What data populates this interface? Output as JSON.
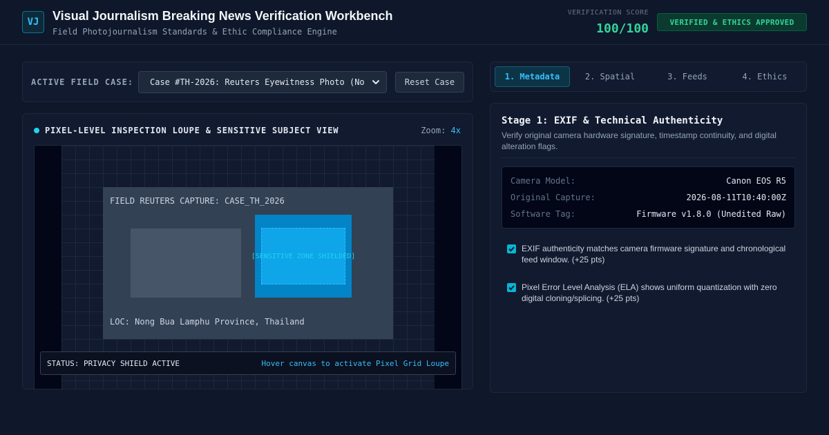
{
  "header": {
    "logo": "VJ",
    "title": "Visual Journalism Breaking News Verification Workbench",
    "subtitle": "Field Photojournalism Standards & Ethic Compliance Engine",
    "score_label": "VERIFICATION SCORE",
    "score_value": "100/100",
    "badge": "VERIFIED & ETHICS APPROVED"
  },
  "case_bar": {
    "label": "ACTIVE FIELD CASE:",
    "selected": "Case #TH-2026: Reuters Eyewitness Photo (No",
    "reset_label": "Reset Case"
  },
  "loupe": {
    "title": "PIXEL-LEVEL INSPECTION LOUPE & SENSITIVE SUBJECT VIEW",
    "zoom_label": "Zoom:",
    "zoom_value": "4x",
    "capture_label": "FIELD REUTERS CAPTURE: CASE_TH_2026",
    "sensitive_label": "[SENSITIVE ZONE SHIELDED]",
    "location_label": "LOC: Nong Bua Lamphu Province, Thailand",
    "status": "STATUS: PRIVACY SHIELD ACTIVE",
    "hover_hint": "Hover canvas to activate Pixel Grid Loupe"
  },
  "tabs": [
    {
      "label": "1. Metadata",
      "active": true
    },
    {
      "label": "2. Spatial",
      "active": false
    },
    {
      "label": "3. Feeds",
      "active": false
    },
    {
      "label": "4. Ethics",
      "active": false
    }
  ],
  "stage": {
    "title": "Stage 1: EXIF & Technical Authenticity",
    "description": "Verify original camera hardware signature, timestamp continuity, and digital alteration flags.",
    "metadata": [
      {
        "key": "Camera Model:",
        "value": "Canon EOS R5"
      },
      {
        "key": "Original Capture:",
        "value": "2026-08-11T10:40:00Z"
      },
      {
        "key": "Software Tag:",
        "value": "Firmware v1.8.0 (Unedited Raw)"
      }
    ],
    "checks": [
      {
        "text": "EXIF authenticity matches camera firmware signature and chronological feed window. (+25 pts)",
        "checked": true
      },
      {
        "text": "Pixel Error Level Analysis (ELA) shows uniform quantization with zero digital cloning/splicing. (+25 pts)",
        "checked": true
      }
    ]
  },
  "colors": {
    "background": "#0f172a",
    "accent": "#38bdf8",
    "success": "#34d399",
    "sensitive_zone": "#0284c7"
  }
}
